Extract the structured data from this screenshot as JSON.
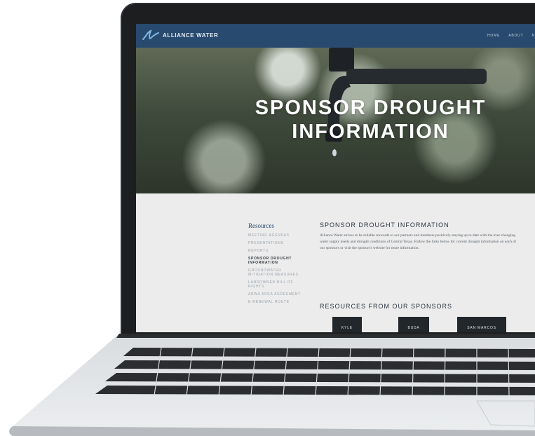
{
  "site": {
    "brand": "ALLIANCE WATER",
    "nav": [
      "HOME",
      "ABOUT",
      "NE"
    ]
  },
  "hero": {
    "line1": "SPONSOR DROUGHT",
    "line2": "INFORMATION"
  },
  "sidebar": {
    "heading": "Resources",
    "items": [
      {
        "label": "MEETING AGENDAS"
      },
      {
        "label": "PRESENTATIONS"
      },
      {
        "label": "REPORTS"
      },
      {
        "label": "SPONSOR DROUGHT INFORMATION"
      },
      {
        "label": "GROUNDWATER MITIGATION MEASURES"
      },
      {
        "label": "LANDOWNER BILL OF RIGHTS"
      },
      {
        "label": "ARWA AREA AGREEMENT"
      },
      {
        "label": "E-RENEWAL ROUTE"
      }
    ]
  },
  "main": {
    "title": "SPONSOR DROUGHT INFORMATION",
    "body": "Alliance Water strives to be reliable stewards to our partners and members positively staying up to date with the ever-changing water supply needs and drought conditions of Central Texas. Follow the links below for current drought information on each of our sponsors or visit the sponsor's website for more information.",
    "resources_title": "RESOURCES FROM OUR SPONSORS",
    "sponsors": [
      "KYLE",
      "BUDA",
      "SAN MARCOS"
    ]
  },
  "colors": {
    "header": "#274a6e",
    "button": "#22272c",
    "laptop_bezel": "#1d1e20"
  }
}
